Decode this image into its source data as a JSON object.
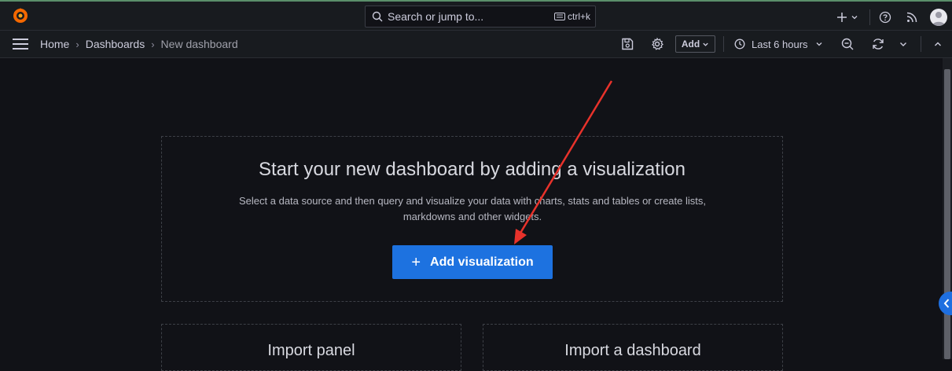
{
  "topbar": {
    "search_placeholder": "Search or jump to...",
    "search_shortcut": "ctrl+k"
  },
  "navbar": {
    "breadcrumbs": [
      "Home",
      "Dashboards",
      "New dashboard"
    ],
    "add_label": "Add",
    "time_range": "Last 6 hours"
  },
  "empty_state": {
    "title": "Start your new dashboard by adding a visualization",
    "description": "Select a data source and then query and visualize your data with charts, stats and tables or create lists, markdowns and other widgets.",
    "button_label": "Add visualization",
    "button_icon": "plus-icon"
  },
  "import": {
    "panel_title": "Import panel",
    "dashboard_title": "Import a dashboard"
  },
  "colors": {
    "background": "#111217",
    "primary_button": "#1d72e0",
    "annotation_arrow": "#e8322b"
  }
}
